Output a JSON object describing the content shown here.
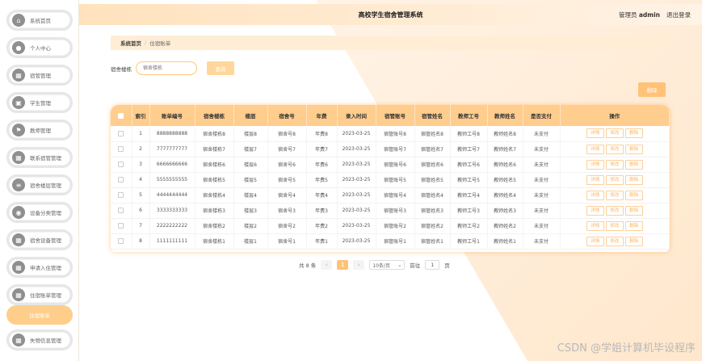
{
  "app": {
    "title": "高校学生宿舍管理系统",
    "user_label": "管理员",
    "user_name": "admin",
    "logout_label": "退出登录"
  },
  "sidebar": {
    "items": [
      {
        "label": "系统首页",
        "icon": "home-icon",
        "glyph": "⌂"
      },
      {
        "label": "个人中心",
        "icon": "user-icon",
        "glyph": "●"
      },
      {
        "label": "宿管管理",
        "icon": "grid-icon",
        "glyph": "▦"
      },
      {
        "label": "学生管理",
        "icon": "book-icon",
        "glyph": "▣"
      },
      {
        "label": "教师管理",
        "icon": "flag-icon",
        "glyph": "⚑"
      },
      {
        "label": "联系宿管管理",
        "icon": "grid-icon",
        "glyph": "▦"
      },
      {
        "label": "宿舍楼层管理",
        "icon": "list-icon",
        "glyph": "≡"
      },
      {
        "label": "设备分类管理",
        "icon": "pin-icon",
        "glyph": "◉"
      },
      {
        "label": "宿舍设备管理",
        "icon": "grid-icon",
        "glyph": "▦"
      },
      {
        "label": "申请入住管理",
        "icon": "grid-icon",
        "glyph": "▦"
      },
      {
        "label": "住宿账单管理",
        "icon": "grid-icon",
        "glyph": "▦"
      },
      {
        "label": "住宿账单",
        "icon": "",
        "glyph": ""
      },
      {
        "label": "失物信息管理",
        "icon": "grid-icon",
        "glyph": "▦"
      }
    ],
    "active_index": 11
  },
  "breadcrumb": {
    "home": "系统首页",
    "current": "住宿账单"
  },
  "search": {
    "label": "宿舍楼栋",
    "placeholder": "宿舍楼栋",
    "button": "查询"
  },
  "toolbar": {
    "delete_label": "删除"
  },
  "table": {
    "columns": [
      "索引",
      "账单编号",
      "宿舍楼栋",
      "楼层",
      "宿舍号",
      "年费",
      "录入时间",
      "宿管账号",
      "宿管姓名",
      "教师工号",
      "教师姓名",
      "是否支付",
      "操作"
    ],
    "actions": [
      "详情",
      "修改",
      "删除"
    ],
    "rows": [
      [
        "1",
        "8888888888",
        "宿舍楼栋8",
        "楼层8",
        "宿舍号8",
        "年费8",
        "2023-03-25",
        "宿管账号8",
        "宿管姓名8",
        "教师工号8",
        "教师姓名8",
        "未支付"
      ],
      [
        "2",
        "7777777777",
        "宿舍楼栋7",
        "楼层7",
        "宿舍号7",
        "年费7",
        "2023-03-25",
        "宿管账号7",
        "宿管姓名7",
        "教师工号7",
        "教师姓名7",
        "未支付"
      ],
      [
        "3",
        "6666666666",
        "宿舍楼栋6",
        "楼层6",
        "宿舍号6",
        "年费6",
        "2023-03-25",
        "宿管账号6",
        "宿管姓名6",
        "教师工号6",
        "教师姓名6",
        "未支付"
      ],
      [
        "4",
        "5555555555",
        "宿舍楼栋5",
        "楼层5",
        "宿舍号5",
        "年费5",
        "2023-03-25",
        "宿管账号5",
        "宿管姓名5",
        "教师工号5",
        "教师姓名5",
        "未支付"
      ],
      [
        "5",
        "4444444444",
        "宿舍楼栋4",
        "楼层4",
        "宿舍号4",
        "年费4",
        "2023-03-25",
        "宿管账号4",
        "宿管姓名4",
        "教师工号4",
        "教师姓名4",
        "未支付"
      ],
      [
        "6",
        "3333333333",
        "宿舍楼栋3",
        "楼层3",
        "宿舍号3",
        "年费3",
        "2023-03-25",
        "宿管账号3",
        "宿管姓名3",
        "教师工号3",
        "教师姓名3",
        "未支付"
      ],
      [
        "7",
        "2222222222",
        "宿舍楼栋2",
        "楼层2",
        "宿舍号2",
        "年费2",
        "2023-03-25",
        "宿管账号2",
        "宿管姓名2",
        "教师工号2",
        "教师姓名2",
        "未支付"
      ],
      [
        "8",
        "1111111111",
        "宿舍楼栋1",
        "楼层1",
        "宿舍号1",
        "年费1",
        "2023-03-25",
        "宿管账号1",
        "宿管姓名1",
        "教师工号1",
        "教师姓名1",
        "未支付"
      ]
    ]
  },
  "pagination": {
    "total_text": "共 8 条",
    "prev": "‹",
    "current_page": "1",
    "next": "›",
    "page_size": "10条/页",
    "goto_label": "前往",
    "goto_value": "1",
    "page_suffix": "页"
  },
  "watermark": "CSDN @学姐计算机毕设程序",
  "colors": {
    "accent": "#ffc277",
    "header_bg": "#ffe2bd",
    "table_head": "#ffcd8e"
  }
}
